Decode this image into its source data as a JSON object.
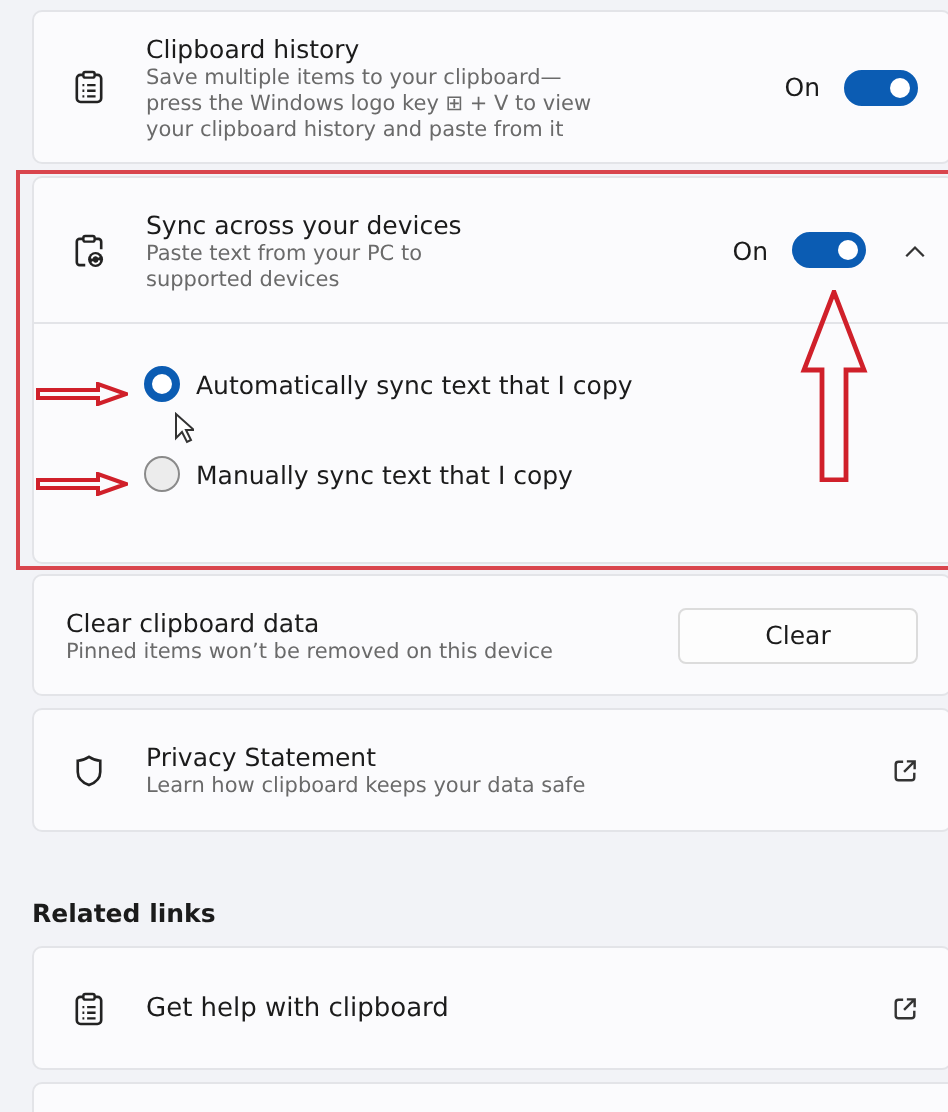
{
  "clipboard_history": {
    "title": "Clipboard history",
    "description": "Save multiple items to your clipboard—press the Windows logo key ⊞ + V to view your clipboard history and paste from it",
    "state_label": "On",
    "on": true
  },
  "sync": {
    "title": "Sync across your devices",
    "description": "Paste text from your PC to supported devices",
    "state_label": "On",
    "on": true,
    "expanded": true,
    "options": [
      {
        "label": "Automatically sync text that I copy",
        "selected": true
      },
      {
        "label": "Manually sync text that I copy",
        "selected": false
      }
    ]
  },
  "clear": {
    "title": "Clear clipboard data",
    "description": "Pinned items won’t be removed on this device",
    "button": "Clear"
  },
  "privacy": {
    "title": "Privacy Statement",
    "description": "Learn how clipboard keeps your data safe"
  },
  "related_links": {
    "heading": "Related links",
    "items": [
      {
        "label": "Get help with clipboard"
      }
    ]
  }
}
